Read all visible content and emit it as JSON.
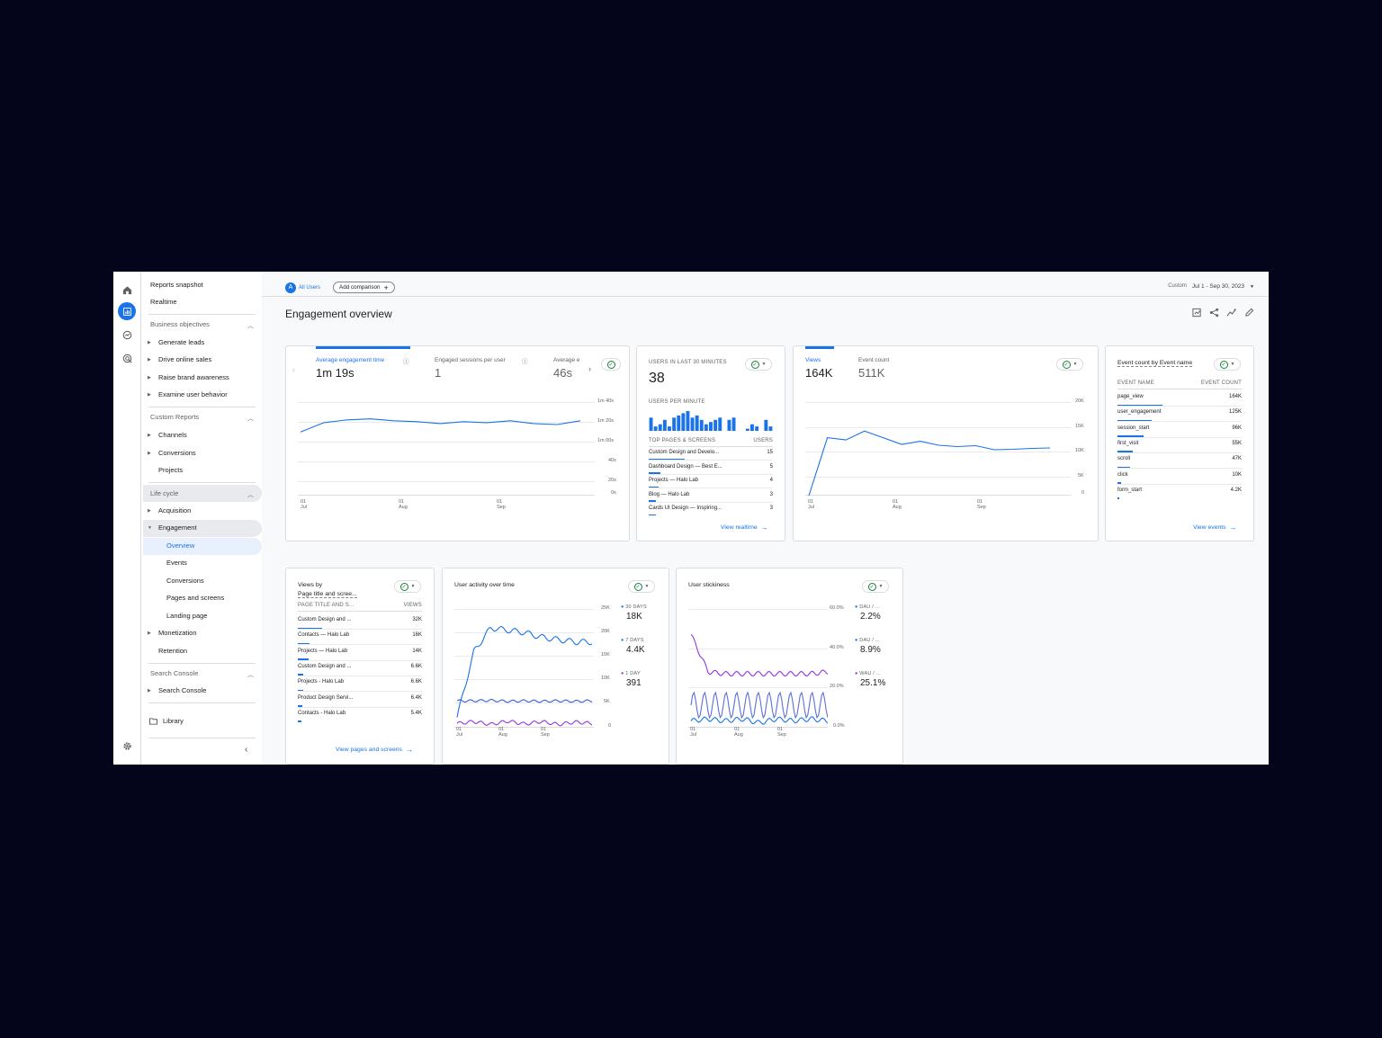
{
  "colors": {
    "accent": "#1a73e8",
    "purple": "#9334e6",
    "line": "#1a73e8",
    "ok": "#188038"
  },
  "rail": {
    "icons": [
      "home-icon",
      "reports-icon",
      "explore-icon",
      "advertising-icon",
      "settings-icon"
    ]
  },
  "nav": {
    "reports_snapshot": "Reports snapshot",
    "realtime": "Realtime",
    "business_objectives": "Business objectives",
    "generate_leads": "Generate leads",
    "drive_online_sales": "Drive online sales",
    "raise_brand_awareness": "Raise brand awareness",
    "examine_user_behavior": "Examine user behavior",
    "custom_reports": "Custom Reports",
    "channels": "Channels",
    "conversions": "Conversions",
    "projects": "Projects",
    "life_cycle": "Life cycle",
    "acquisition": "Acquisition",
    "engagement": "Engagement",
    "overview": "Overview",
    "events": "Events",
    "conversions2": "Conversions",
    "pages_and_screens": "Pages and screens",
    "landing_page": "Landing page",
    "monetization": "Monetization",
    "retention": "Retention",
    "search_console": "Search Console",
    "search_console_item": "Search Console",
    "library": "Library"
  },
  "topbar": {
    "avatar_letter": "A",
    "all_users": "All Users",
    "add_comparison": "Add comparison",
    "custom": "Custom",
    "date_range": "Jul 1 - Sep 30, 2023"
  },
  "page_title": "Engagement overview",
  "card1": {
    "tabs": [
      {
        "label": "Average engagement time",
        "value": "1m 19s"
      },
      {
        "label": "Engaged sessions per user",
        "value": "1"
      },
      {
        "label": "Average e",
        "value": "46s"
      }
    ],
    "y_ticks": [
      "1m 40s",
      "1m 20s",
      "1m 00s",
      "40s",
      "20s",
      "0s"
    ],
    "x_ticks": [
      {
        "d": "01",
        "m": "Jul"
      },
      {
        "d": "01",
        "m": "Aug"
      },
      {
        "d": "01",
        "m": "Sep"
      }
    ]
  },
  "card2": {
    "users_last_30": "USERS IN LAST 30 MINUTES",
    "users_value": "38",
    "users_per_minute": "USERS PER MINUTE",
    "table_h1": "TOP PAGES & SCREENS",
    "table_h2": "USERS",
    "rows": [
      {
        "name": "Custom Design and Develo...",
        "value": "15"
      },
      {
        "name": "Dashboard Design — Best E...",
        "value": "5"
      },
      {
        "name": "Projects — Halo Lab",
        "value": "4"
      },
      {
        "name": "Blog — Halo Lab",
        "value": "3"
      },
      {
        "name": "Cards UI Design — Inspiring...",
        "value": "3"
      }
    ],
    "link": "View realtime"
  },
  "card3": {
    "tab1_label": "Views",
    "tab1_value": "164K",
    "tab2_label": "Event count",
    "tab2_value": "511K",
    "y_ticks": [
      "20K",
      "15K",
      "10K",
      "5K",
      "0"
    ],
    "x_ticks": [
      {
        "d": "01",
        "m": "Jul"
      },
      {
        "d": "01",
        "m": "Aug"
      },
      {
        "d": "01",
        "m": "Sep"
      }
    ]
  },
  "card4": {
    "title": "Event count by Event name",
    "h1": "EVENT NAME",
    "h2": "EVENT COUNT",
    "rows": [
      {
        "name": "page_view",
        "value": "164K"
      },
      {
        "name": "user_engagement",
        "value": "125K"
      },
      {
        "name": "session_start",
        "value": "96K"
      },
      {
        "name": "first_visit",
        "value": "55K"
      },
      {
        "name": "scroll",
        "value": "47K"
      },
      {
        "name": "click",
        "value": "10K"
      },
      {
        "name": "form_start",
        "value": "4.2K"
      }
    ],
    "link": "View events"
  },
  "card5": {
    "title1": "Views by",
    "title2": "Page title and scree...",
    "h1": "PAGE TITLE AND S...",
    "h2": "VIEWS",
    "rows": [
      {
        "name": "Custom Design and ...",
        "value": "32K"
      },
      {
        "name": "Contacts — Halo Lab",
        "value": "16K"
      },
      {
        "name": "Projects — Halo Lab",
        "value": "14K"
      },
      {
        "name": "Custom Design and ...",
        "value": "6.6K"
      },
      {
        "name": "Projects - Halo Lab",
        "value": "6.6K"
      },
      {
        "name": "Product Design Servi...",
        "value": "6.4K"
      },
      {
        "name": "Contacts - Halo Lab",
        "value": "5.4K"
      }
    ],
    "link": "View pages and screens"
  },
  "card6": {
    "title": "User activity over time",
    "y_ticks": [
      "25K",
      "20K",
      "15K",
      "10K",
      "5K",
      "0"
    ],
    "x_ticks": [
      {
        "d": "01",
        "m": "Jul"
      },
      {
        "d": "01",
        "m": "Aug"
      },
      {
        "d": "01",
        "m": "Sep"
      }
    ],
    "legend": [
      {
        "label": "30 DAYS",
        "value": "18K",
        "color": "#1a73e8"
      },
      {
        "label": "7 DAYS",
        "value": "4.4K",
        "color": "#1a73e8"
      },
      {
        "label": "1 DAY",
        "value": "391",
        "color": "#9334e6"
      }
    ]
  },
  "card7": {
    "title": "User stickiness",
    "y_ticks": [
      "60.0%",
      "40.0%",
      "20.0%",
      "0.0%"
    ],
    "x_ticks": [
      {
        "d": "01",
        "m": "Jul"
      },
      {
        "d": "01",
        "m": "Aug"
      },
      {
        "d": "01",
        "m": "Sep"
      }
    ],
    "legend": [
      {
        "label": "DAU / ...",
        "value": "2.2%",
        "color": "#1a73e8"
      },
      {
        "label": "DAU / ...",
        "value": "8.9%",
        "color": "#1a73e8"
      },
      {
        "label": "WAU / ...",
        "value": "25.1%",
        "color": "#9334e6"
      }
    ]
  },
  "chart_data": [
    {
      "type": "line",
      "title": "Average engagement time",
      "ylim": [
        0,
        100
      ],
      "y_unit": "seconds",
      "series": [
        {
          "values": [
            68,
            78,
            81,
            82,
            80,
            79,
            77,
            79,
            78,
            80,
            77,
            76,
            80
          ]
        }
      ]
    },
    {
      "type": "bar",
      "title": "USERS PER MINUTE",
      "values": [
        6,
        2,
        3,
        5,
        2,
        6,
        7,
        8,
        9,
        6,
        7,
        5,
        3,
        4,
        5,
        6,
        0,
        5,
        6,
        0,
        0,
        1,
        3,
        2,
        0,
        5,
        2
      ]
    },
    {
      "type": "line",
      "title": "Views",
      "ylim": [
        0,
        20000
      ],
      "series": [
        {
          "values": [
            0,
            13000,
            12500,
            14500,
            13000,
            11500,
            12200,
            11300,
            11000,
            11200,
            10300,
            10400,
            10600,
            10700
          ]
        }
      ]
    },
    {
      "type": "line",
      "title": "User activity over time",
      "ylim": [
        0,
        25000
      ],
      "series": [
        {
          "name": "30 DAYS",
          "values": [
            2000,
            16000,
            21000,
            20500,
            20000,
            19000,
            18500,
            18000,
            18000
          ]
        },
        {
          "name": "7 DAYS",
          "values": [
            5500,
            5500,
            5600,
            5400,
            5500,
            5400,
            5500,
            5400,
            5500
          ]
        },
        {
          "name": "1 DAY",
          "values": [
            700,
            1100,
            500,
            1200,
            600,
            1100,
            500,
            1000,
            700
          ]
        }
      ]
    },
    {
      "type": "line",
      "title": "User stickiness",
      "ylim": [
        0,
        60
      ],
      "series": [
        {
          "name": "DAU / ...",
          "values": [
            3,
            4,
            3,
            4,
            2,
            4,
            3,
            4,
            3
          ]
        },
        {
          "name": "DAU / ...",
          "values": [
            16,
            6,
            18,
            5,
            17,
            6,
            18,
            5,
            16
          ]
        },
        {
          "name": "WAU / ...",
          "values": [
            47,
            28,
            27,
            27,
            27,
            27,
            27,
            27,
            28
          ]
        }
      ]
    }
  ]
}
